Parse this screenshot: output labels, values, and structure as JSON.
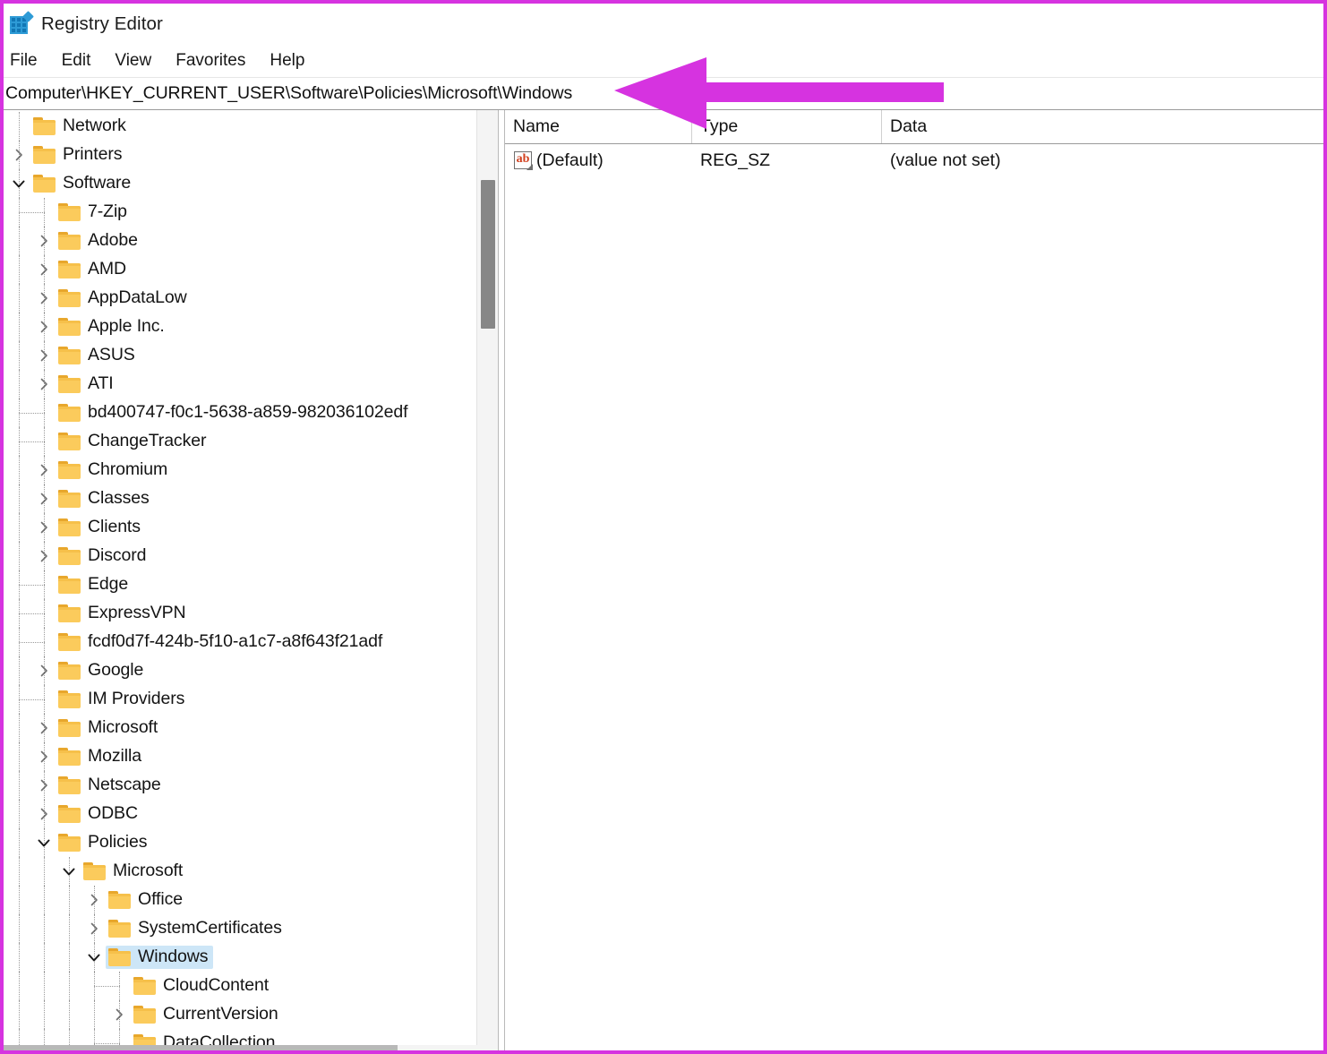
{
  "window": {
    "title": "Registry Editor",
    "icon": "registry-editor-icon"
  },
  "menu": {
    "items": [
      {
        "label": "File"
      },
      {
        "label": "Edit"
      },
      {
        "label": "View"
      },
      {
        "label": "Favorites"
      },
      {
        "label": "Help"
      }
    ]
  },
  "address": {
    "path": "Computer\\HKEY_CURRENT_USER\\Software\\Policies\\Microsoft\\Windows"
  },
  "tree": {
    "rows": [
      {
        "label": "Network",
        "depth": 1,
        "twisty": "none",
        "selected": false
      },
      {
        "label": "Printers",
        "depth": 1,
        "twisty": "collapsed",
        "selected": false
      },
      {
        "label": "Software",
        "depth": 1,
        "twisty": "expanded",
        "selected": false
      },
      {
        "label": "7-Zip",
        "depth": 2,
        "twisty": "none",
        "selected": false
      },
      {
        "label": "Adobe",
        "depth": 2,
        "twisty": "collapsed",
        "selected": false
      },
      {
        "label": "AMD",
        "depth": 2,
        "twisty": "collapsed",
        "selected": false
      },
      {
        "label": "AppDataLow",
        "depth": 2,
        "twisty": "collapsed",
        "selected": false
      },
      {
        "label": "Apple Inc.",
        "depth": 2,
        "twisty": "collapsed",
        "selected": false
      },
      {
        "label": "ASUS",
        "depth": 2,
        "twisty": "collapsed",
        "selected": false
      },
      {
        "label": "ATI",
        "depth": 2,
        "twisty": "collapsed",
        "selected": false
      },
      {
        "label": "bd400747-f0c1-5638-a859-982036102edf",
        "depth": 2,
        "twisty": "none",
        "selected": false
      },
      {
        "label": "ChangeTracker",
        "depth": 2,
        "twisty": "none",
        "selected": false
      },
      {
        "label": "Chromium",
        "depth": 2,
        "twisty": "collapsed",
        "selected": false
      },
      {
        "label": "Classes",
        "depth": 2,
        "twisty": "collapsed",
        "selected": false
      },
      {
        "label": "Clients",
        "depth": 2,
        "twisty": "collapsed",
        "selected": false
      },
      {
        "label": "Discord",
        "depth": 2,
        "twisty": "collapsed",
        "selected": false
      },
      {
        "label": "Edge",
        "depth": 2,
        "twisty": "none",
        "selected": false
      },
      {
        "label": "ExpressVPN",
        "depth": 2,
        "twisty": "none",
        "selected": false
      },
      {
        "label": "fcdf0d7f-424b-5f10-a1c7-a8f643f21adf",
        "depth": 2,
        "twisty": "none",
        "selected": false
      },
      {
        "label": "Google",
        "depth": 2,
        "twisty": "collapsed",
        "selected": false
      },
      {
        "label": "IM Providers",
        "depth": 2,
        "twisty": "none",
        "selected": false
      },
      {
        "label": "Microsoft",
        "depth": 2,
        "twisty": "collapsed",
        "selected": false
      },
      {
        "label": "Mozilla",
        "depth": 2,
        "twisty": "collapsed",
        "selected": false
      },
      {
        "label": "Netscape",
        "depth": 2,
        "twisty": "collapsed",
        "selected": false
      },
      {
        "label": "ODBC",
        "depth": 2,
        "twisty": "collapsed",
        "selected": false
      },
      {
        "label": "Policies",
        "depth": 2,
        "twisty": "expanded",
        "selected": false
      },
      {
        "label": "Microsoft",
        "depth": 3,
        "twisty": "expanded",
        "selected": false
      },
      {
        "label": "Office",
        "depth": 4,
        "twisty": "collapsed",
        "selected": false
      },
      {
        "label": "SystemCertificates",
        "depth": 4,
        "twisty": "collapsed",
        "selected": false
      },
      {
        "label": "Windows",
        "depth": 4,
        "twisty": "expanded",
        "selected": true
      },
      {
        "label": "CloudContent",
        "depth": 5,
        "twisty": "none",
        "selected": false
      },
      {
        "label": "CurrentVersion",
        "depth": 5,
        "twisty": "collapsed",
        "selected": false
      },
      {
        "label": "DataCollection",
        "depth": 5,
        "twisty": "none",
        "selected": false
      }
    ]
  },
  "values": {
    "columns": [
      {
        "label": "Name"
      },
      {
        "label": "Type"
      },
      {
        "label": "Data"
      }
    ],
    "rows": [
      {
        "name": "(Default)",
        "type": "REG_SZ",
        "data": "(value not set)",
        "icon": "string-value-icon"
      }
    ]
  },
  "annotation": {
    "arrow_color": "#d633e0",
    "border_color": "#d633e0"
  }
}
